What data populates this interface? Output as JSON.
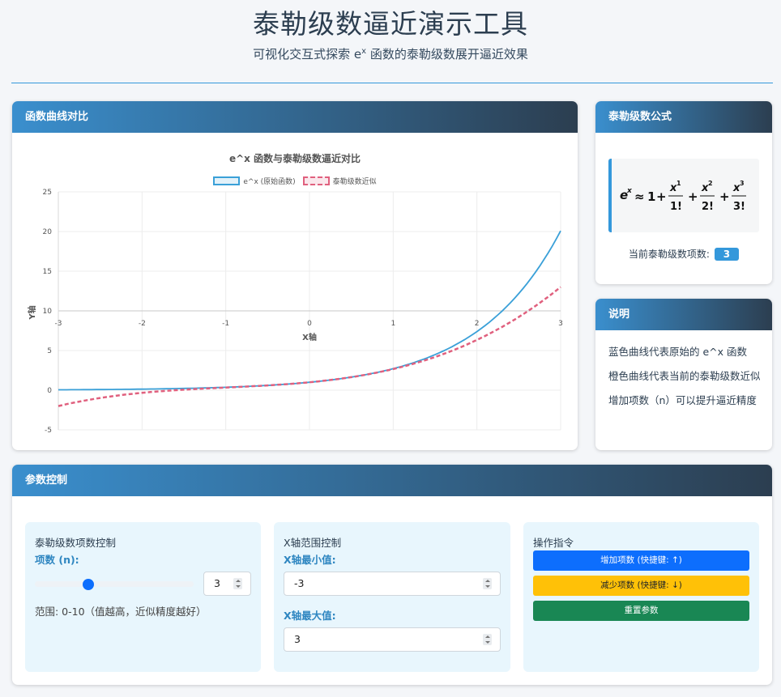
{
  "header": {
    "title": "泰勒级数逼近演示工具",
    "subtitle_before": "可视化交互式探索 e",
    "subtitle_sup": "x",
    "subtitle_after": " 函数的泰勒级数展开逼近效果"
  },
  "chart_card": {
    "title": "函数曲线对比"
  },
  "chart_data": {
    "type": "line",
    "title": "e^x 函数与泰勒级数逼近对比",
    "xlabel": "X轴",
    "ylabel": "Y轴",
    "xlim": [
      -3,
      3
    ],
    "ylim": [
      -5,
      25
    ],
    "x_ticks": [
      "-3",
      "-2",
      "-1",
      "0",
      "1",
      "2",
      "3"
    ],
    "y_ticks": [
      "25",
      "20",
      "15",
      "10",
      "5",
      "0",
      "-5"
    ],
    "grid": true,
    "legend_position": "top",
    "x": [
      -3,
      -2.5,
      -2,
      -1.5,
      -1,
      -0.5,
      0,
      0.5,
      1,
      1.5,
      2,
      2.5,
      3
    ],
    "series": [
      {
        "name": "e^x (原始函数)",
        "color": "#3aa0d8",
        "style": "solid",
        "values": [
          0.05,
          0.08,
          0.14,
          0.22,
          0.37,
          0.61,
          1.0,
          1.65,
          2.72,
          4.48,
          7.39,
          12.18,
          20.09
        ]
      },
      {
        "name": "泰勒级数近似",
        "color": "#e0607e",
        "style": "dashed",
        "values": [
          -2.0,
          -0.98,
          -0.33,
          0.06,
          0.33,
          0.6,
          1.0,
          1.65,
          2.67,
          4.19,
          6.33,
          9.23,
          13.0
        ]
      }
    ]
  },
  "formula_card": {
    "title": "泰勒级数公式",
    "terms_label": "当前泰勒级数项数:",
    "terms_value": "3"
  },
  "notes_card": {
    "title": "说明",
    "items": [
      "蓝色曲线代表原始的 e^x 函数",
      "橙色曲线代表当前的泰勒级数近似",
      "增加项数（n）可以提升逼近精度"
    ]
  },
  "controls_card": {
    "title": "参数控制",
    "terms_panel": {
      "title": "泰勒级数项数控制",
      "label": "项数 (n):",
      "value": "3",
      "slider_fraction": 0.3,
      "range_note": "范围: 0-10（值越高，近似精度越好）"
    },
    "range_panel": {
      "title": "X轴范围控制",
      "min_label": "X轴最小值:",
      "min_value": "-3",
      "max_label": "X轴最大值:",
      "max_value": "3"
    },
    "ops_panel": {
      "title": "操作指令",
      "increase": "增加项数 (快捷键: ↑)",
      "decrease": "减少项数 (快捷键: ↓)",
      "reset": "重置参数"
    }
  },
  "colors": {
    "accent": "#3498db",
    "header_gradient_end": "#2c3e50",
    "button_blue": "#0d6efd",
    "button_yellow": "#ffc107",
    "button_green": "#198754"
  }
}
